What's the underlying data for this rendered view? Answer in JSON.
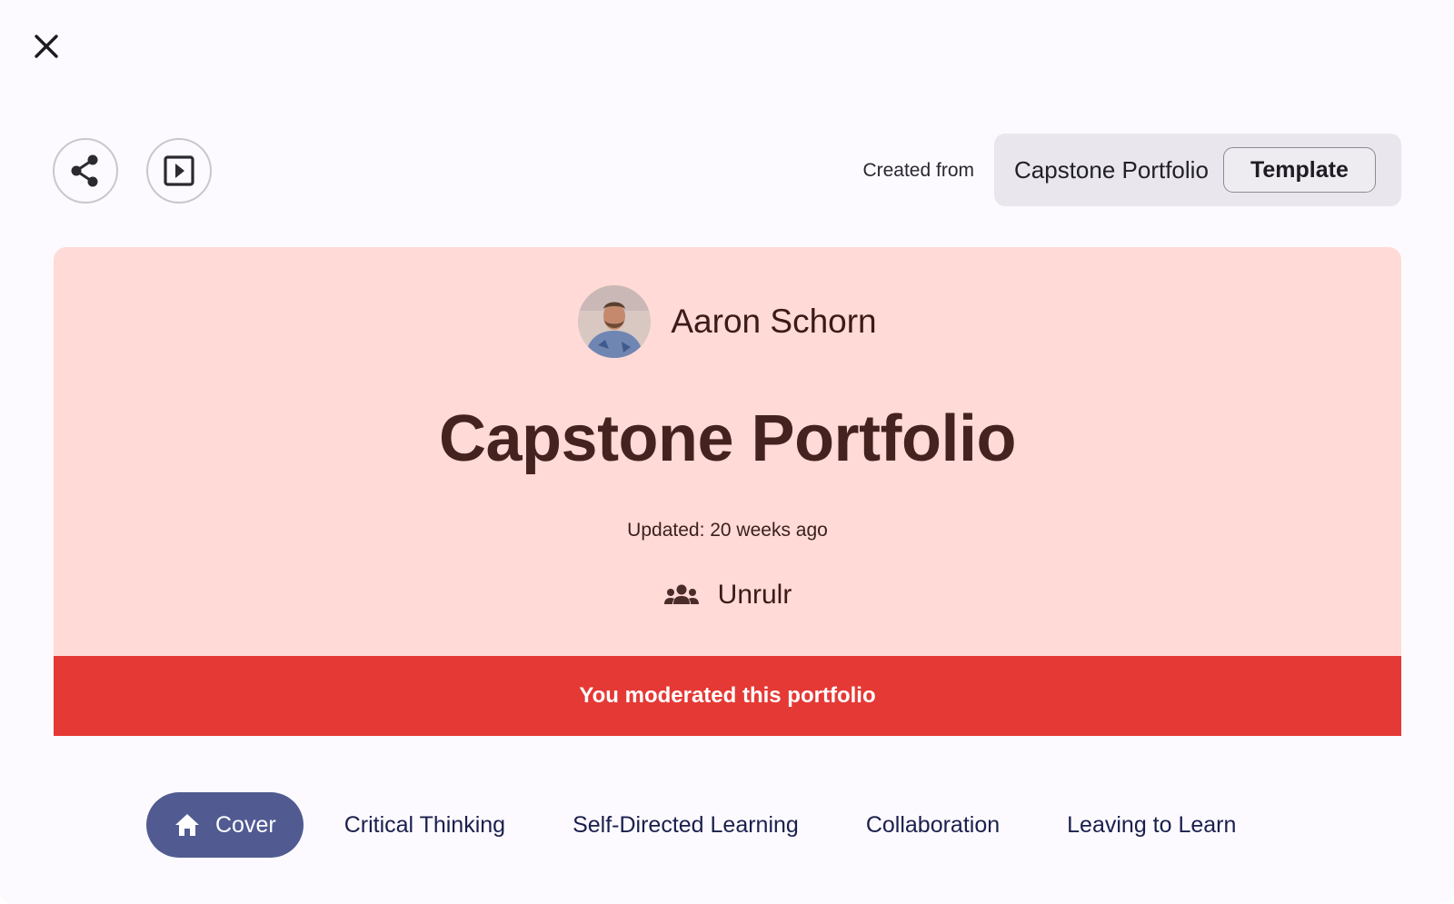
{
  "header": {
    "close_icon": "close-icon",
    "share_icon": "share-icon",
    "present_icon": "slideshow-icon",
    "created_from_label": "Created from",
    "template_name": "Capstone Portfolio",
    "template_badge": "Template"
  },
  "cover": {
    "author_name": "Aaron Schorn",
    "title": "Capstone Portfolio",
    "updated": "Updated: 20 weeks ago",
    "group_icon": "groups-icon",
    "group_name": "Unrulr",
    "moderated_banner": "You moderated this portfolio",
    "colors": {
      "card_bg": "#ffdad6",
      "banner_bg": "#e53935",
      "title_text": "#442220"
    }
  },
  "tabs": [
    {
      "label": "Cover",
      "icon": "home-icon",
      "active": true
    },
    {
      "label": "Critical Thinking",
      "active": false
    },
    {
      "label": "Self-Directed Learning",
      "active": false
    },
    {
      "label": "Collaboration",
      "active": false
    },
    {
      "label": "Leaving to Learn",
      "active": false
    }
  ],
  "colors": {
    "active_tab_bg": "#515b92",
    "tab_text": "#1a1f4d",
    "page_bg": "#fcfaff"
  }
}
